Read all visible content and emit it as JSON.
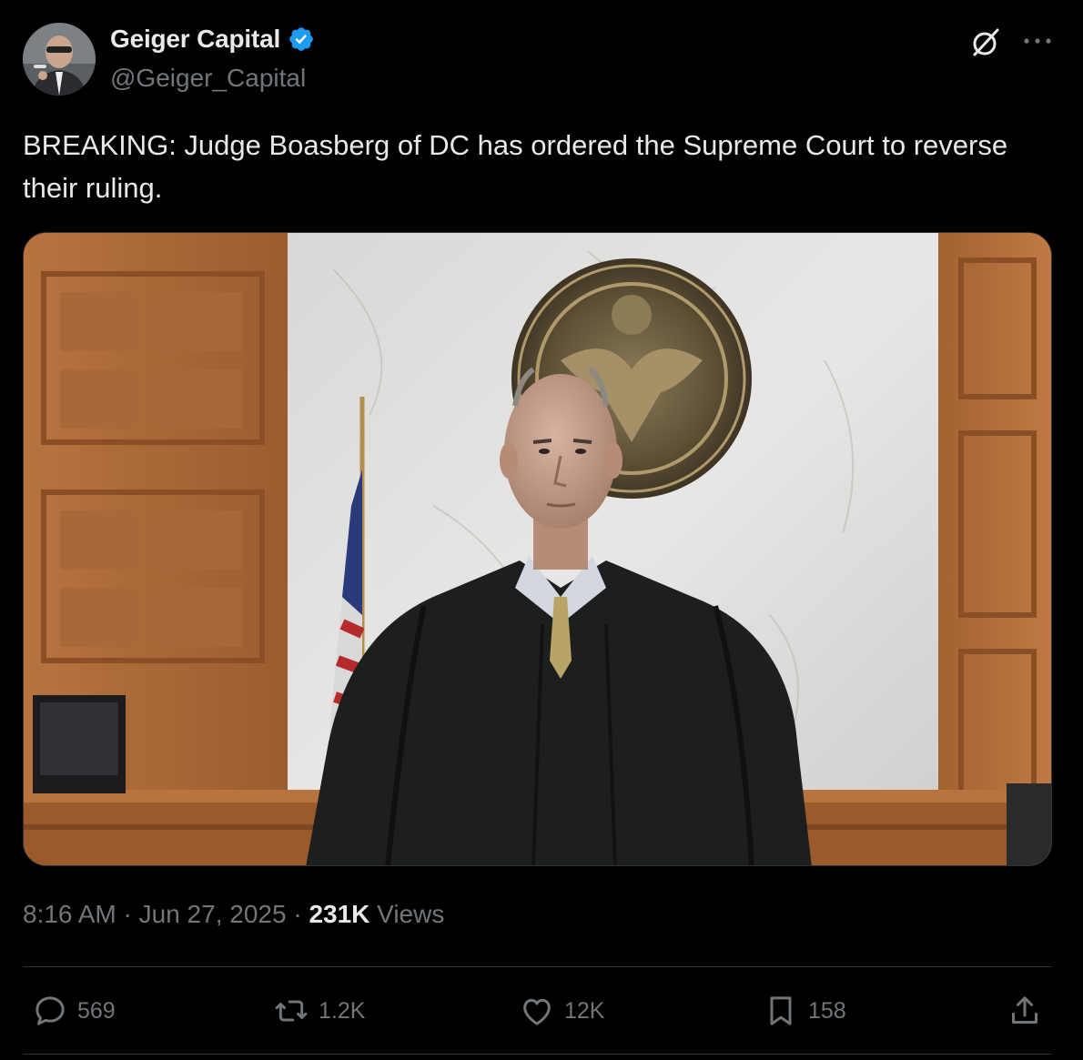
{
  "author": {
    "display_name": "Geiger Capital",
    "handle": "@Geiger_Capital",
    "verified": true
  },
  "tweet": {
    "text": "BREAKING: Judge Boasberg of DC has ordered the Supreme Court to reverse their ruling."
  },
  "meta": {
    "time": "8:16 AM",
    "separator": "·",
    "date": "Jun 27, 2025",
    "views_count": "231K",
    "views_label": "Views"
  },
  "actions": {
    "replies": "569",
    "reposts": "1.2K",
    "likes": "12K",
    "bookmarks": "158"
  },
  "icons": {
    "verified": "verified-badge-icon",
    "grok": "grok-icon",
    "more": "more-icon",
    "reply": "reply-icon",
    "repost": "repost-icon",
    "like": "like-icon",
    "bookmark": "bookmark-icon",
    "share": "share-icon"
  },
  "colors": {
    "background": "#000000",
    "text": "#e7e9ea",
    "secondary": "#71767b",
    "verified": "#1d9bf0",
    "divider": "#2f3336"
  }
}
